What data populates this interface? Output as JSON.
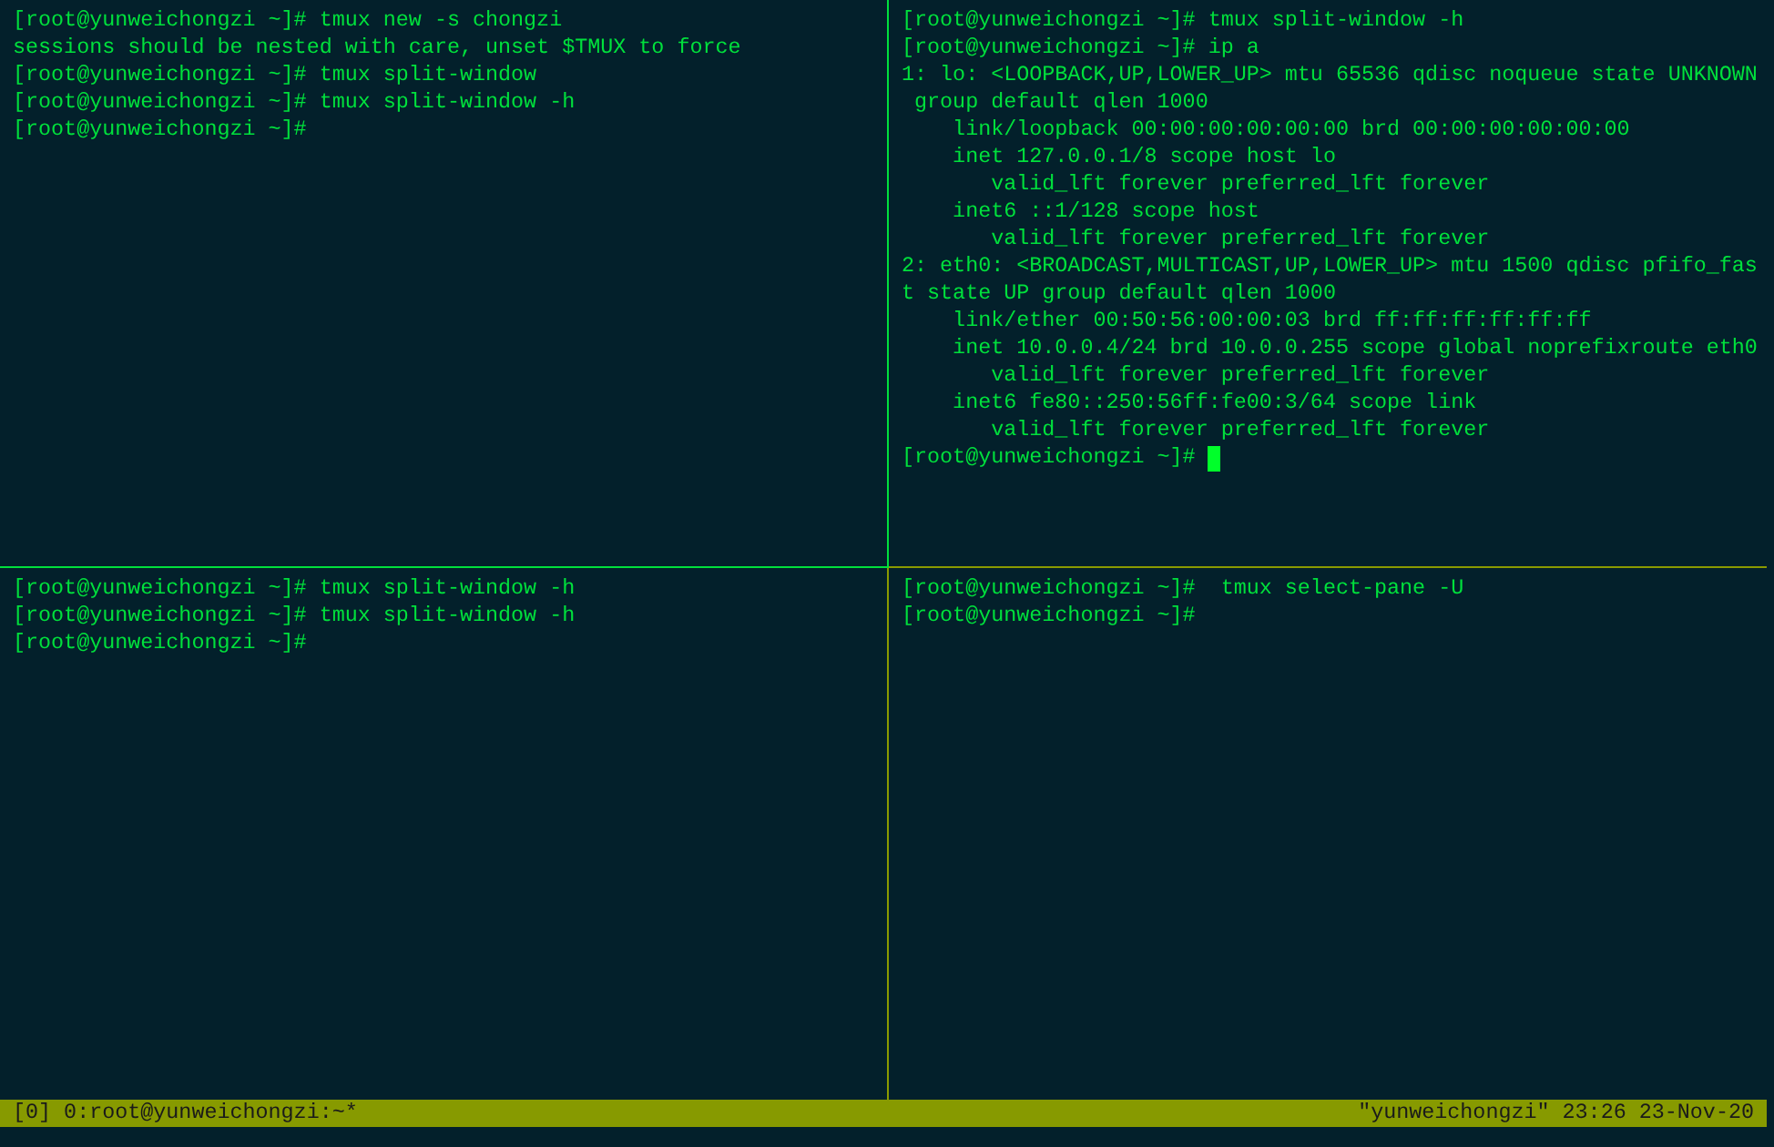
{
  "panes": [
    {
      "active": false,
      "lines": [
        "[root@yunweichongzi ~]# tmux new -s chongzi",
        "sessions should be nested with care, unset $TMUX to force",
        "[root@yunweichongzi ~]# tmux split-window",
        "[root@yunweichongzi ~]# tmux split-window -h",
        "[root@yunweichongzi ~]#"
      ]
    },
    {
      "active": true,
      "lines": [
        "[root@yunweichongzi ~]# tmux split-window -h",
        "[root@yunweichongzi ~]# ip a",
        "1: lo: <LOOPBACK,UP,LOWER_UP> mtu 65536 qdisc noqueue state UNKNOWN",
        " group default qlen 1000",
        "    link/loopback 00:00:00:00:00:00 brd 00:00:00:00:00:00",
        "    inet 127.0.0.1/8 scope host lo",
        "       valid_lft forever preferred_lft forever",
        "    inet6 ::1/128 scope host",
        "       valid_lft forever preferred_lft forever",
        "2: eth0: <BROADCAST,MULTICAST,UP,LOWER_UP> mtu 1500 qdisc pfifo_fas",
        "t state UP group default qlen 1000",
        "    link/ether 00:50:56:00:00:03 brd ff:ff:ff:ff:ff:ff",
        "    inet 10.0.0.4/24 brd 10.0.0.255 scope global noprefixroute eth0",
        "       valid_lft forever preferred_lft forever",
        "    inet6 fe80::250:56ff:fe00:3/64 scope link",
        "       valid_lft forever preferred_lft forever",
        "[root@yunweichongzi ~]#"
      ]
    },
    {
      "active": false,
      "lines": [
        "[root@yunweichongzi ~]# tmux split-window -h",
        "[root@yunweichongzi ~]# tmux split-window -h",
        "[root@yunweichongzi ~]#"
      ]
    },
    {
      "active": false,
      "lines": [
        "[root@yunweichongzi ~]#  tmux select-pane -U",
        "[root@yunweichongzi ~]#"
      ]
    }
  ],
  "status_bar": {
    "left": "[0] 0:root@yunweichongzi:~*",
    "right": "\"yunweichongzi\" 23:26 23-Nov-20"
  }
}
